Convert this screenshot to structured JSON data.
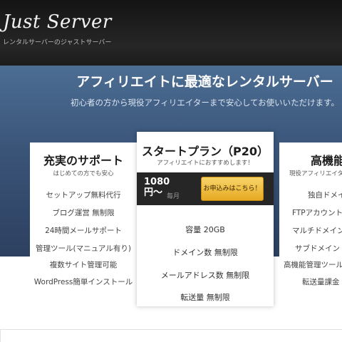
{
  "header": {
    "logo": "Just Server",
    "tagline": "レンタルサーバーのジャストサーバー"
  },
  "hero": {
    "title": "アフィリエイトに最適なレンタルサーバー",
    "subtitle": "初心者の方から現役アフィリエイターまで安心してお使いいただけます。"
  },
  "plans": {
    "support": {
      "title": "充実のサポート",
      "subtitle": "はじめての方でも安心",
      "features": [
        "セットアップ無料代行",
        "ブログ運営 無制限",
        "24時間メールサポート",
        "管理ツール(マニュアル有り)",
        "複数サイト管理可能",
        "WordPress簡単インストール"
      ]
    },
    "start": {
      "title": "スタートプラン（P20）",
      "subtitle": "アフィリエイトにおすすめします！",
      "price": "1080円～",
      "price_unit": "毎月",
      "apply_label": "お申込みはこちら！",
      "specs": [
        "容量 20GB",
        "ドメイン数 無制限",
        "メールアドレス数 無制限",
        "転送量 無制限"
      ]
    },
    "pro": {
      "title": "高機能",
      "subtitle": "現役アフィリエイター",
      "features": [
        "独自ドメイン",
        "FTPアカウント",
        "マルチドメイン",
        "サブドメイン",
        "高機能管理ツール",
        "転送量課金"
      ]
    }
  },
  "colors": {
    "hero_top": "#4c6d93",
    "hero_bottom": "#2d4060",
    "header_bg": "#1f1f1f",
    "price_bar": "#262626",
    "button": "#f0be3c"
  }
}
